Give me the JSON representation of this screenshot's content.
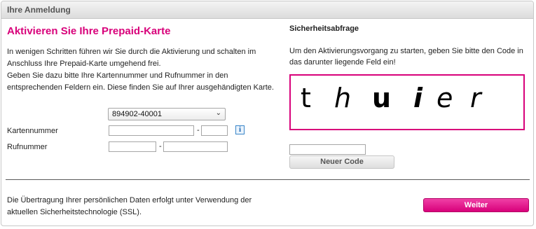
{
  "header": {
    "title": "Ihre Anmeldung"
  },
  "left": {
    "title": "Aktivieren Sie Ihre Prepaid-Karte",
    "intro_line1": "In wenigen Schritten führen wir Sie durch die Aktivierung und schalten im",
    "intro_line2": "Anschluss Ihre Prepaid-Karte umgehend frei.",
    "intro_line3": "Geben Sie dazu bitte Ihre Kartennummer und Rufnummer in den",
    "intro_line4": "entsprechenden Feldern ein. Diese finden Sie auf Ihrer ausgehändigten Karte.",
    "select_value": "894902-40001",
    "kartennummer_label": "Kartennummer",
    "rufnummer_label": "Rufnummer",
    "separator": "-",
    "info_icon": "i"
  },
  "right": {
    "title": "Sicherheitsabfrage",
    "text_line1": "Um den Aktivierungsvorgang zu starten, geben Sie bitte den Code in",
    "text_line2": "das darunter liegende Feld ein!",
    "captcha": {
      "c1": "t",
      "c2": "h",
      "c3": "u",
      "c4": "i",
      "c5": "e",
      "c6": "r"
    },
    "new_code_button": "Neuer Code"
  },
  "footer": {
    "text_line1": "Die Übertragung Ihrer persönlichen Daten erfolgt unter Verwendung der",
    "text_line2": "aktuellen Sicherheitstechnologie (SSL).",
    "next_button": "Weiter"
  },
  "colors": {
    "accent": "#d8007a",
    "info": "#1a64b4"
  }
}
